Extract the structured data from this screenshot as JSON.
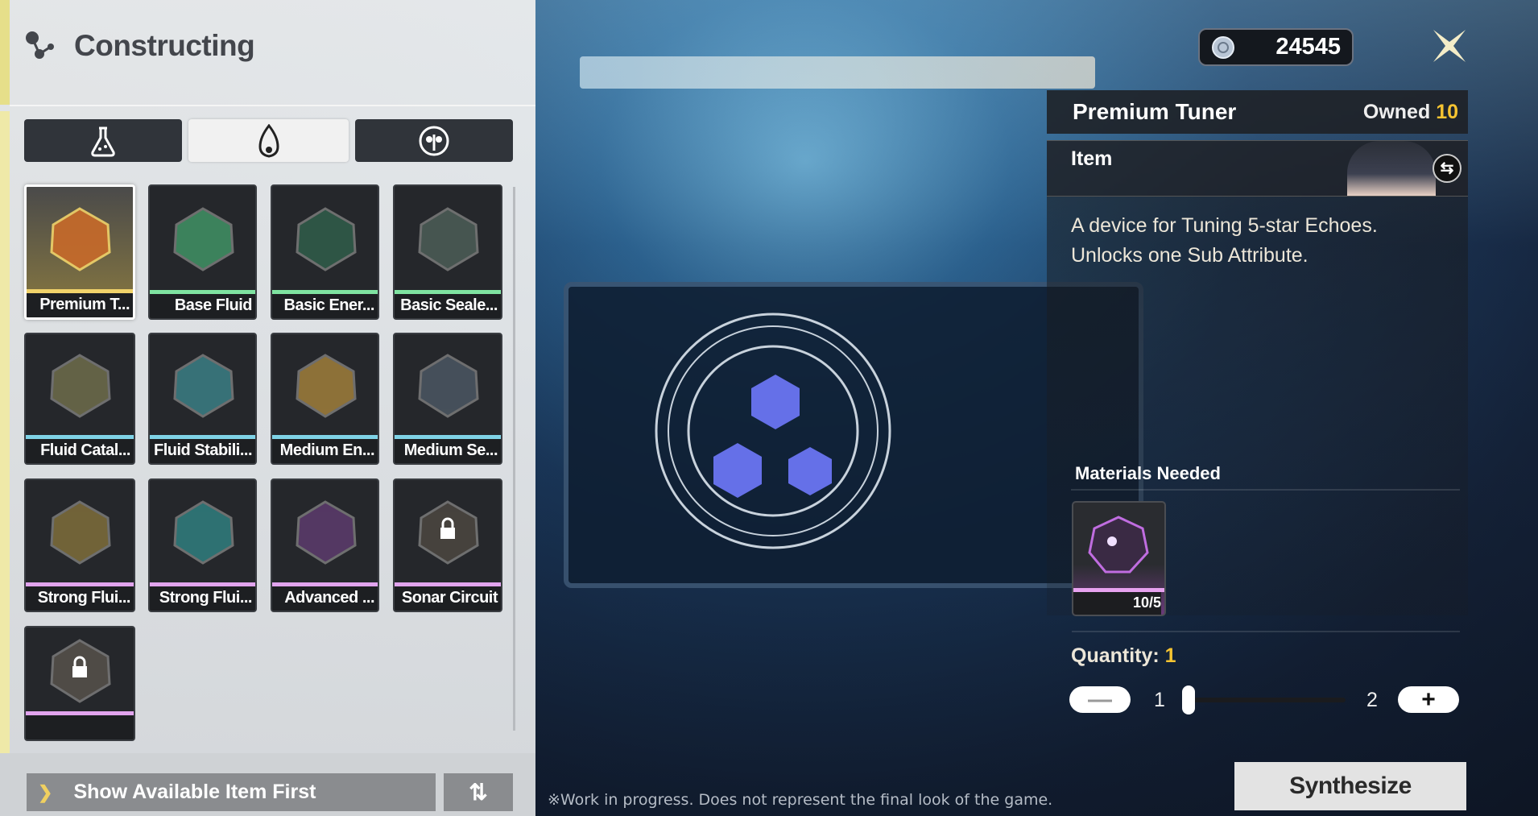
{
  "header": {
    "title": "Constructing",
    "icon": "molecule-icon"
  },
  "tabs": [
    {
      "icon": "flask-icon",
      "active": false
    },
    {
      "icon": "flame-drop-icon",
      "active": true
    },
    {
      "icon": "echo-mask-icon",
      "active": false
    }
  ],
  "rarity_colors": {
    "gold": "#f1d36a",
    "green": "#7fe3a1",
    "blue": "#7fd3e6",
    "purple": "#e2a4ee"
  },
  "items": [
    {
      "name": "Premium T...",
      "rarity": "gold",
      "color": "#c86a2a",
      "selected": true,
      "locked": false
    },
    {
      "name": "Base Fluid",
      "rarity": "green",
      "color": "#3f8c62",
      "selected": false,
      "locked": false
    },
    {
      "name": "Basic Ener...",
      "rarity": "green",
      "color": "#2f5a48",
      "selected": false,
      "locked": false
    },
    {
      "name": "Basic Seale...",
      "rarity": "green",
      "color": "#4a5a55",
      "selected": false,
      "locked": false
    },
    {
      "name": "Fluid Catal...",
      "rarity": "blue",
      "color": "#6b6a4a",
      "selected": false,
      "locked": false
    },
    {
      "name": "Fluid Stabili...",
      "rarity": "blue",
      "color": "#3a7a80",
      "selected": false,
      "locked": false
    },
    {
      "name": "Medium En...",
      "rarity": "blue",
      "color": "#9a7a3a",
      "selected": false,
      "locked": false
    },
    {
      "name": "Medium Se...",
      "rarity": "blue",
      "color": "#4a5560",
      "selected": false,
      "locked": false
    },
    {
      "name": "Strong Flui...",
      "rarity": "purple",
      "color": "#7a6a3a",
      "selected": false,
      "locked": false
    },
    {
      "name": "Strong Flui...",
      "rarity": "purple",
      "color": "#2f7a7a",
      "selected": false,
      "locked": false
    },
    {
      "name": "Advanced ...",
      "rarity": "purple",
      "color": "#5a3a6a",
      "selected": false,
      "locked": false
    },
    {
      "name": "Sonar Circuit",
      "rarity": "purple",
      "color": "#4a4540",
      "selected": false,
      "locked": true
    },
    {
      "name": "",
      "rarity": "purple",
      "color": "#55504a",
      "selected": false,
      "locked": true
    }
  ],
  "filter": {
    "label": "Show Available Item First",
    "sort_icon": "sort-icon"
  },
  "currency": {
    "amount": "24545",
    "icon": "shell-credit-icon"
  },
  "detail": {
    "name": "Premium Tuner",
    "owned_label": "Owned",
    "owned_value": "10",
    "type": "Item",
    "description": "A device for Tuning 5-star Echoes. Unlocks one Sub Attribute.",
    "materials_label": "Materials Needed",
    "materials": [
      {
        "count": "10/5",
        "rarity": "purple"
      }
    ],
    "quantity_label": "Quantity:",
    "quantity_value": "1",
    "slider_min": "1",
    "slider_max": "2",
    "slider_fraction": 0,
    "synthesize_label": "Synthesize"
  },
  "footer_note": "※Work in progress. Does not represent the final look of the game."
}
